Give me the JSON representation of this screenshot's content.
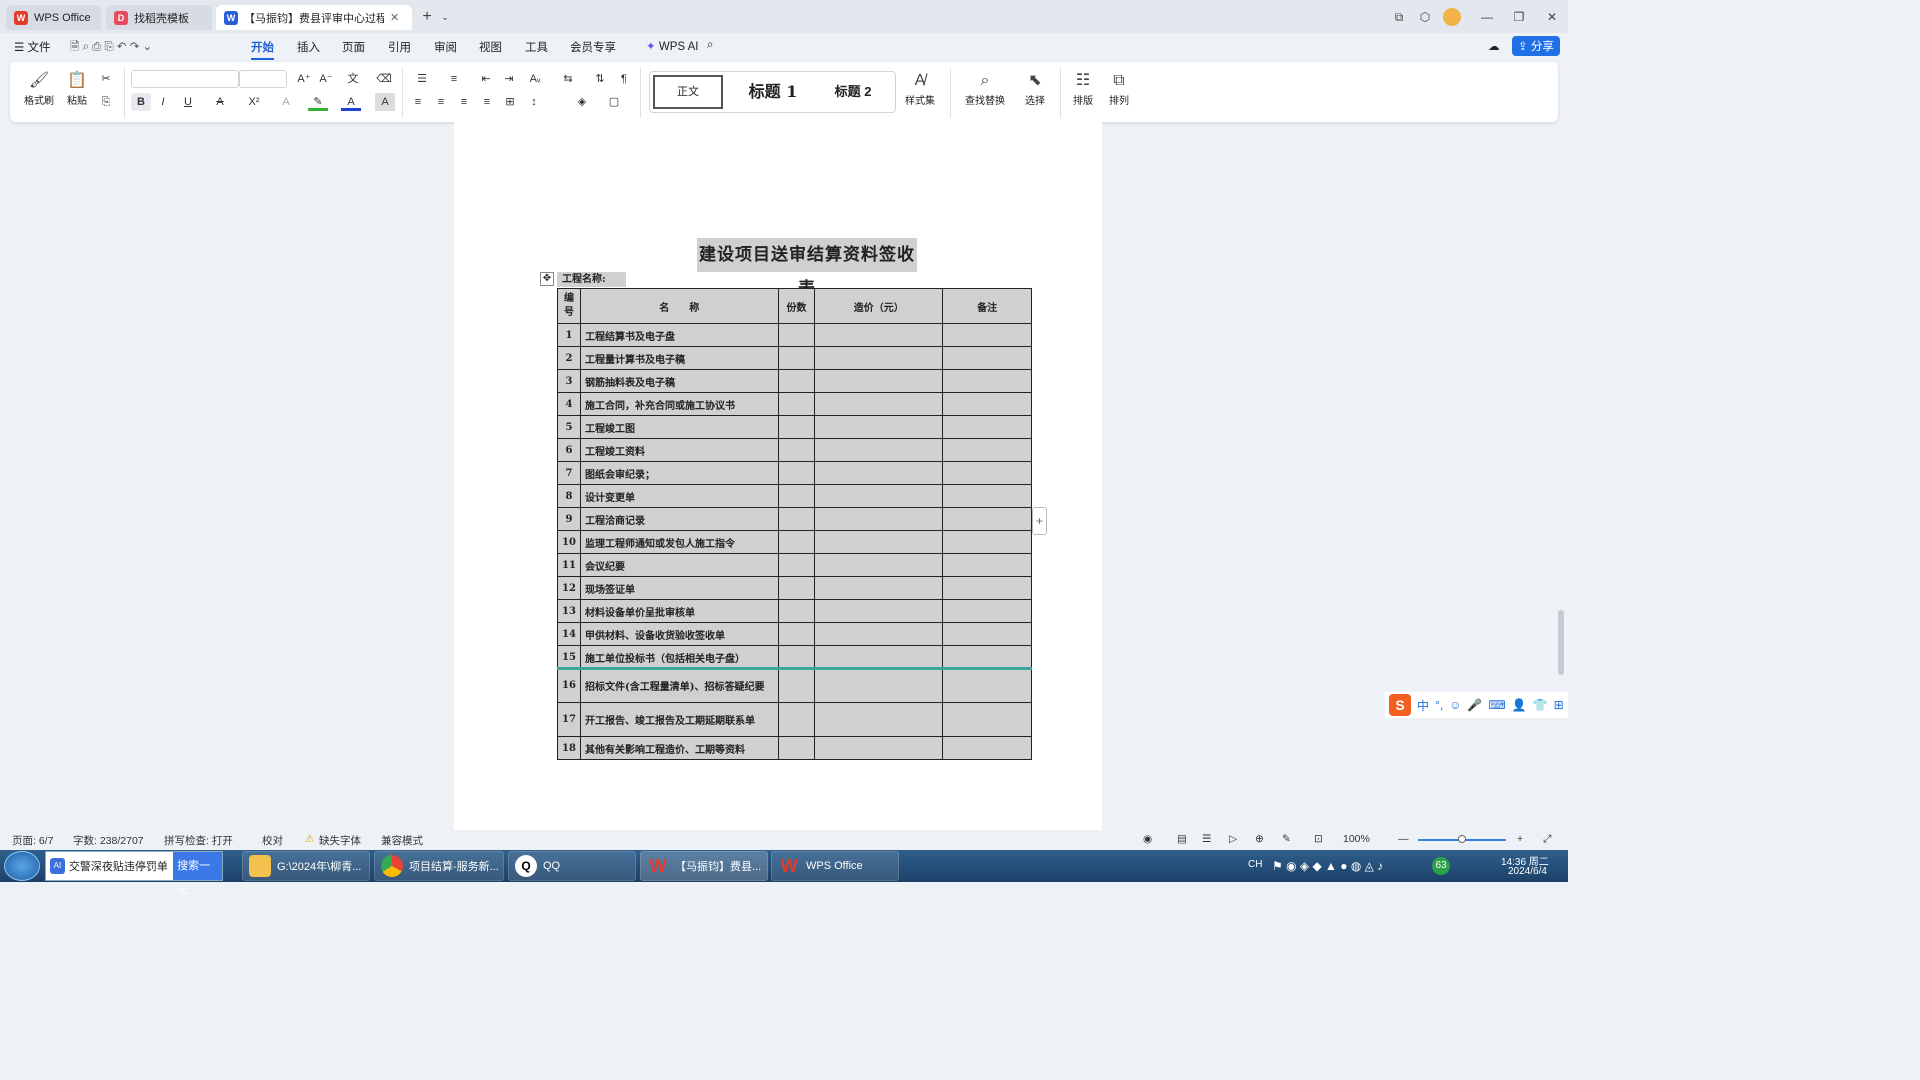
{
  "tabs": [
    {
      "label": "WPS Office",
      "icon": "wps-logo-icon",
      "color": "#e23b2e"
    },
    {
      "label": "找稻壳模板",
      "icon": "docer-icon",
      "color": "#e84a5f"
    },
    {
      "label": "【马振钧】费县评审中心过程...",
      "icon": "word-doc-icon",
      "color": "#2b5fd9"
    }
  ],
  "menu": {
    "file": "文件",
    "items": [
      "开始",
      "插入",
      "页面",
      "引用",
      "审阅",
      "视图",
      "工具",
      "会员专享"
    ],
    "selected": "开始",
    "wps_ai": "WPS AI",
    "share": "分享"
  },
  "ribbon": {
    "format_painter": "格式刷",
    "paste": "粘贴",
    "style_normal": "正文",
    "style_h1": "标题 1",
    "style_h2": "标题 2",
    "style_set": "样式集",
    "find_replace": "查找替换",
    "select": "选择",
    "layout": "排版",
    "arrange": "排列"
  },
  "document": {
    "title": "建设项目送审结算资料签收表",
    "project_name_label": "工程名称:",
    "table_headers": [
      "编号",
      "名　　称",
      "份数",
      "造价（元）",
      "备注"
    ],
    "rows": [
      {
        "no": "1",
        "name": "工程结算书及电子盘"
      },
      {
        "no": "2",
        "name": "工程量计算书及电子稿"
      },
      {
        "no": "3",
        "name": "钢筋抽料表及电子稿"
      },
      {
        "no": "4",
        "name": "施工合同，补充合同或施工协议书"
      },
      {
        "no": "5",
        "name": "工程竣工图"
      },
      {
        "no": "6",
        "name": "工程竣工资料"
      },
      {
        "no": "7",
        "name": "图纸会审纪录；"
      },
      {
        "no": "8",
        "name": "设计变更单"
      },
      {
        "no": "9",
        "name": "工程洽商记录"
      },
      {
        "no": "10",
        "name": "监理工程师通知或发包人施工指令"
      },
      {
        "no": "11",
        "name": "会议纪要"
      },
      {
        "no": "12",
        "name": "现场签证单"
      },
      {
        "no": "13",
        "name": "材料设备单价呈批审核单"
      },
      {
        "no": "14",
        "name": "甲供材料、设备收货验收签收单"
      },
      {
        "no": "15",
        "name": "施工单位投标书（包括相关电子盘）"
      },
      {
        "no": "16",
        "name": "招标文件(含工程量清单)、招标答疑纪要"
      },
      {
        "no": "17",
        "name": "开工报告、竣工报告及工期延期联系单"
      },
      {
        "no": "18",
        "name": "其他有关影响工程造价、工期等资料"
      }
    ]
  },
  "ime": {
    "mode": "中"
  },
  "status": {
    "page": "页面: 6/7",
    "words": "字数: 238/2707",
    "spellcheck": "拼写检查: 打开",
    "proof": "校对",
    "missing_font": "缺失字体",
    "compat": "兼容模式",
    "zoom": "100%"
  },
  "taskbar": {
    "search_text": "交警深夜贴违停罚单",
    "search_btn": "搜索一下",
    "items": [
      {
        "label": "G:\\2024年\\柳青...",
        "icon": "folder-icon",
        "color": "#f2c14e"
      },
      {
        "label": "项目结算-服务新...",
        "icon": "chrome-icon",
        "color": "#4caf50"
      },
      {
        "label": "QQ",
        "icon": "qq-icon",
        "color": "#ffffff"
      },
      {
        "label": "【马振钧】费县...",
        "icon": "wps-writer-icon",
        "color": "#e23b2e"
      },
      {
        "label": "WPS Office",
        "icon": "wps-office-icon",
        "color": "#e23b2e"
      }
    ],
    "lang": "CH",
    "time": "14:36 周二",
    "date": "2024/6/4",
    "badge": "63"
  }
}
